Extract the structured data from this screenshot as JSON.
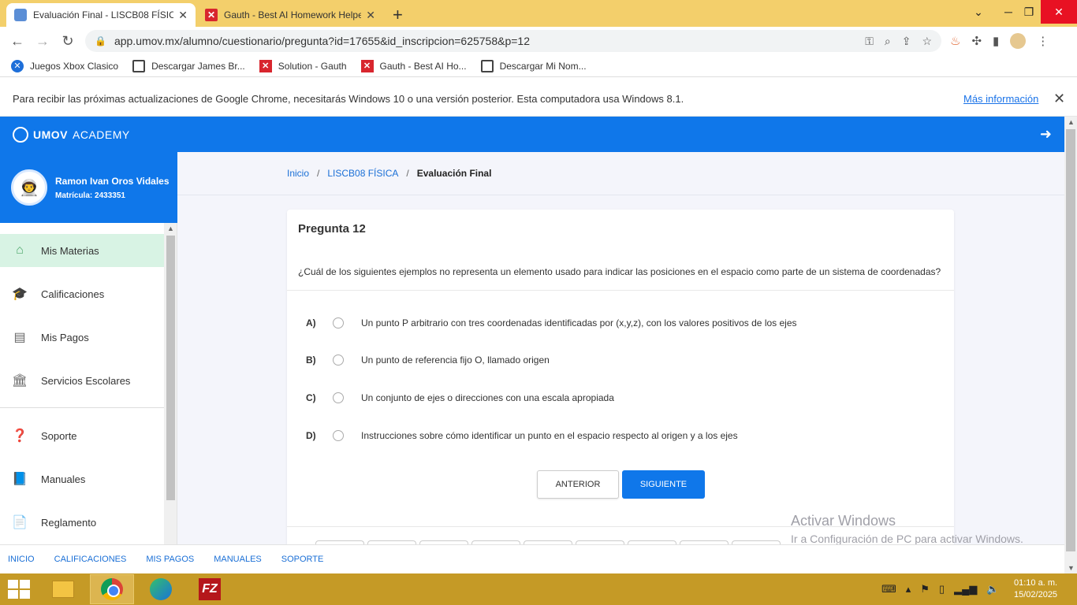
{
  "browser": {
    "tabs": [
      {
        "title": "Evaluación Final - LISCB08 FÍSICA",
        "close": "✕"
      },
      {
        "title": "Gauth - Best AI Homework Helper",
        "close": "✕"
      }
    ],
    "new_tab": "+",
    "url": "app.umov.mx/alumno/cuestionario/pregunta?id=17655&id_inscripcion=625758&p=12",
    "bookmarks": [
      {
        "label": "Juegos Xbox Clasico",
        "icon": "xbox-icon"
      },
      {
        "label": "Descargar James Br...",
        "icon": "film-icon"
      },
      {
        "label": "Solution - Gauth",
        "icon": "gauth-icon"
      },
      {
        "label": "Gauth - Best AI Ho...",
        "icon": "gauth-icon"
      },
      {
        "label": "Descargar Mi Nom...",
        "icon": "film-icon"
      }
    ],
    "infobar": {
      "message": "Para recibir las próximas actualizaciones de Google Chrome, necesitarás Windows 10 o una versión posterior. Esta computadora usa Windows 8.1.",
      "link": "Más información"
    }
  },
  "app": {
    "brand_bold": "UMOV",
    "brand_rest": "ACADEMY",
    "user_name": "Ramon Ivan Oros Vidales",
    "matricula": "Matrícula: 2433351",
    "sidebar": [
      {
        "label": "Mis Materias",
        "icon": "home-icon",
        "active": true
      },
      {
        "label": "Calificaciones",
        "icon": "graduation-cap-icon"
      },
      {
        "label": "Mis Pagos",
        "icon": "wallet-icon"
      },
      {
        "label": "Servicios Escolares",
        "icon": "bank-icon"
      },
      {
        "label": "Soporte",
        "icon": "question-icon"
      },
      {
        "label": "Manuales",
        "icon": "book-icon"
      },
      {
        "label": "Reglamento",
        "icon": "document-icon"
      }
    ],
    "breadcrumb": {
      "home": "Inicio",
      "course": "LISCB08 FÍSICA",
      "current": "Evaluación Final",
      "sep": "/"
    },
    "question": {
      "title": "Pregunta 12",
      "text": "¿Cuál de los siguientes ejemplos no representa un elemento usado para indicar las posiciones en el espacio como parte de un sistema de coordenadas?",
      "options": [
        {
          "letter": "A)",
          "text": "Un punto P arbitrario con tres coordenadas identificadas por (x,y,z), con los valores positivos de los ejes"
        },
        {
          "letter": "B)",
          "text": "Un punto de referencia fijo O, llamado origen"
        },
        {
          "letter": "C)",
          "text": "Un conjunto de ejes o direcciones con una escala apropiada"
        },
        {
          "letter": "D)",
          "text": "Instrucciones sobre cómo identificar un punto en el espacio respecto al origen y a los ejes"
        }
      ],
      "prev_label": "ANTERIOR",
      "next_label": "SIGUIENTE"
    },
    "footer": [
      "INICIO",
      "CALIFICACIONES",
      "MIS PAGOS",
      "MANUALES",
      "SOPORTE"
    ]
  },
  "watermark": {
    "line1": "Activar Windows",
    "line2": "Ir a Configuración de PC para activar Windows."
  },
  "taskbar": {
    "time": "01:10 a. m.",
    "date": "15/02/2025"
  }
}
